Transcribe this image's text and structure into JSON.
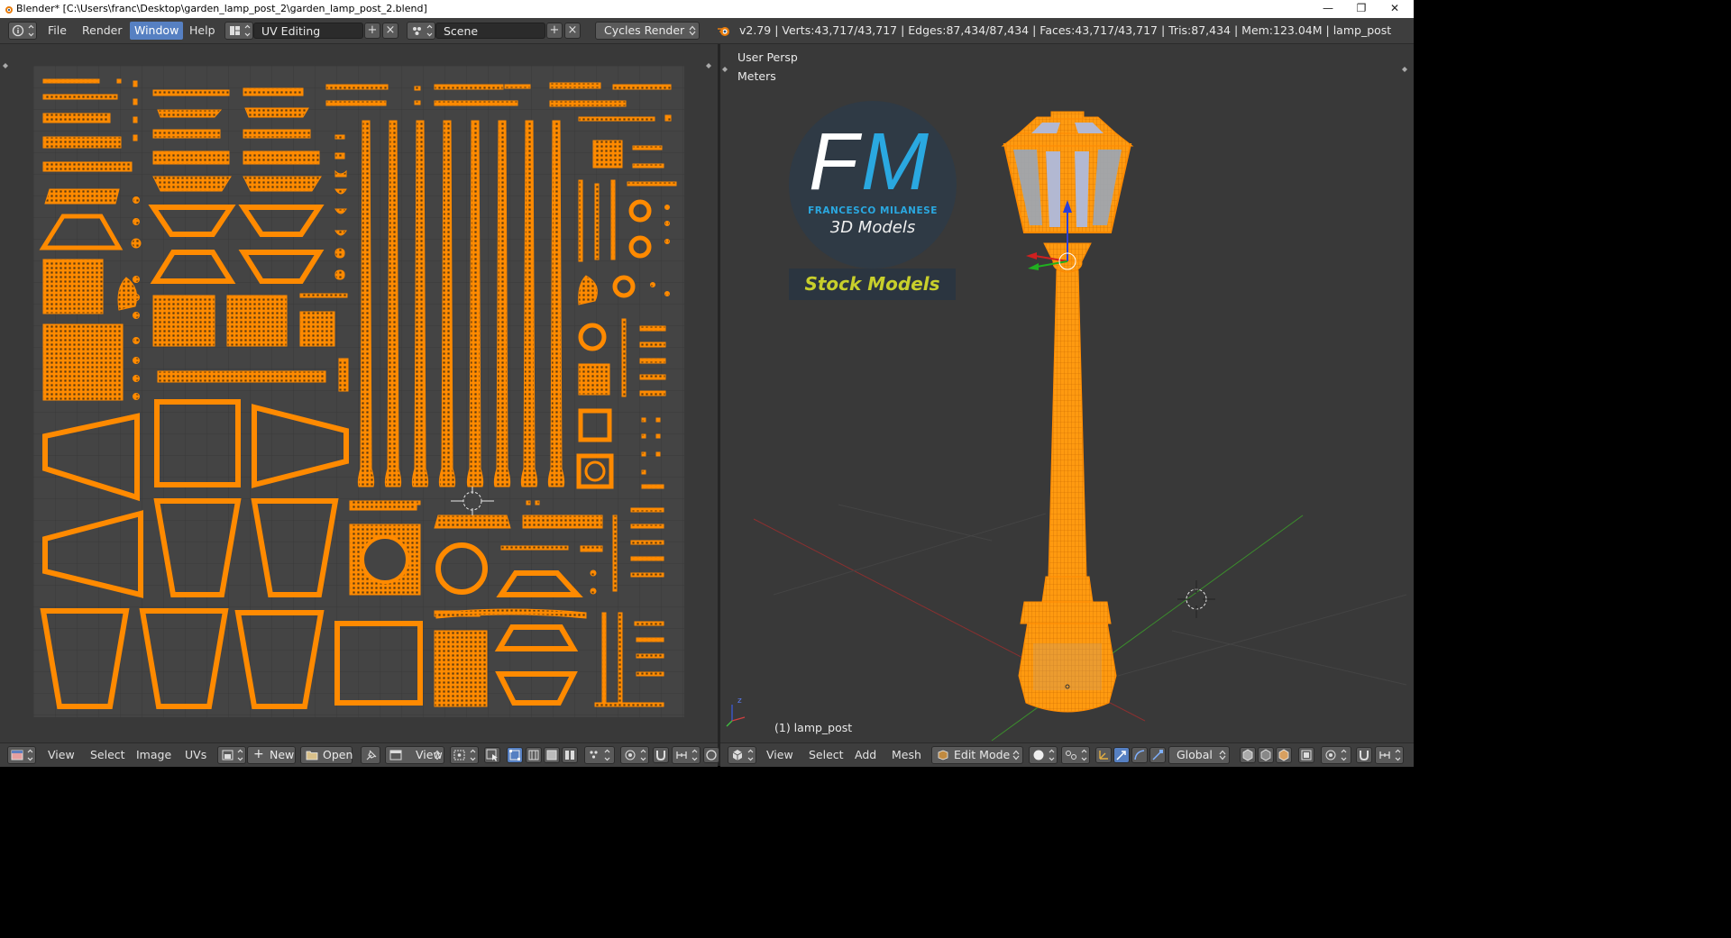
{
  "titlebar": {
    "title": "Blender* [C:\\Users\\franc\\Desktop\\garden_lamp_post_2\\garden_lamp_post_2.blend]",
    "minimize": "—",
    "maximize": "❐",
    "close": "✕"
  },
  "header": {
    "menus": [
      "File",
      "Render",
      "Window",
      "Help"
    ],
    "active_menu": "Window",
    "screen_layout": "UV Editing",
    "scene": "Scene",
    "render_engine": "Cycles Render",
    "stats": "v2.79 | Verts:43,717/43,717 | Edges:87,434/87,434 | Faces:43,717/43,717 | Tris:87,434 | Mem:123.04M | lamp_post"
  },
  "uv_footer": {
    "items": [
      "View",
      "Select",
      "Image",
      "UVs"
    ],
    "new_label": "New",
    "open_label": "Open",
    "view_label": "View"
  },
  "viewport": {
    "view_name": "User Persp",
    "units": "Meters",
    "object_label": "(1) lamp_post",
    "logo_initials_f": "F",
    "logo_initials_m": "M",
    "logo_subtitle": "FRANCESCO MILANESE",
    "logo_tagline": "3D Models",
    "banner": "Stock Models"
  },
  "view3d_footer": {
    "items": [
      "View",
      "Select",
      "Add",
      "Mesh"
    ],
    "mode": "Edit Mode",
    "orientation": "Global"
  },
  "colors": {
    "accent": "#5680c2",
    "uv_orange": "#ff8a00",
    "logo_blue": "#2aa8e0",
    "banner_yellow": "#c8cf2b"
  }
}
